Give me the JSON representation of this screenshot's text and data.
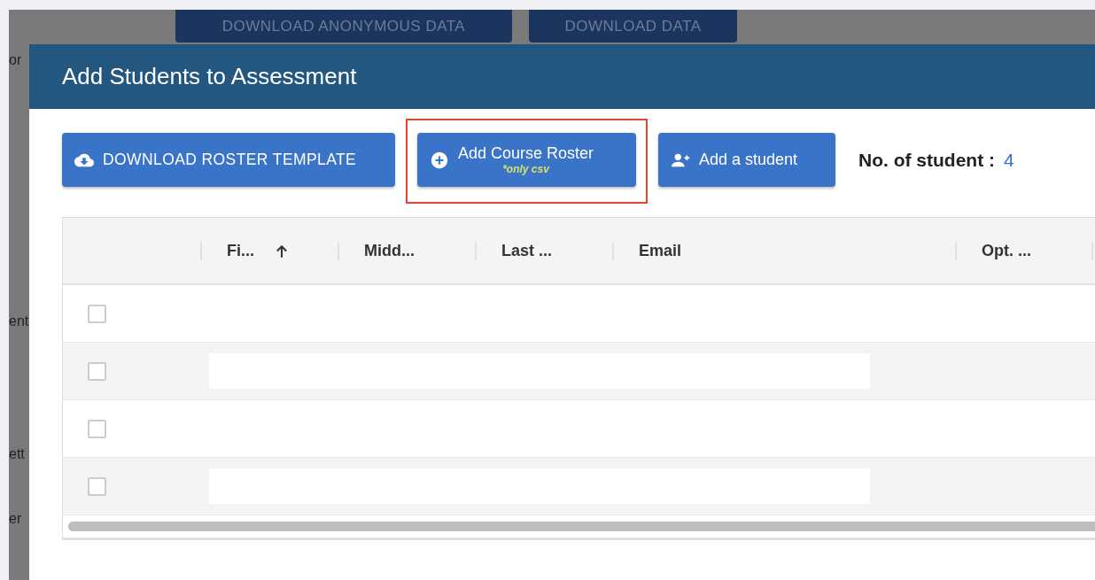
{
  "background": {
    "buttons": [
      "DOWNLOAD ANONYMOUS DATA",
      "DOWNLOAD DATA"
    ],
    "fragments": [
      "or",
      "ent",
      "ett",
      "er"
    ]
  },
  "dialog": {
    "title": "Add Students to Assessment",
    "actions": [
      {
        "kind": "download",
        "label": "DOWNLOAD ROSTER TEMPLATE",
        "highlighted": false
      },
      {
        "kind": "upload",
        "label": "Add Course Roster",
        "note": "*only csv",
        "highlighted": true
      },
      {
        "kind": "add-person",
        "label": "Add a student",
        "highlighted": false
      }
    ],
    "count": {
      "label": "No. of student :",
      "value": "4"
    },
    "table": {
      "columns": [
        {
          "label": "Fi...",
          "sorted": true
        },
        {
          "label": "Midd...",
          "sorted": false
        },
        {
          "label": "Last ...",
          "sorted": false
        },
        {
          "label": "Email",
          "sorted": false
        },
        {
          "label": "Opt. ...",
          "sorted": false
        }
      ],
      "rows": [
        {
          "checked": false
        },
        {
          "checked": false
        },
        {
          "checked": false
        },
        {
          "checked": false
        }
      ]
    }
  }
}
